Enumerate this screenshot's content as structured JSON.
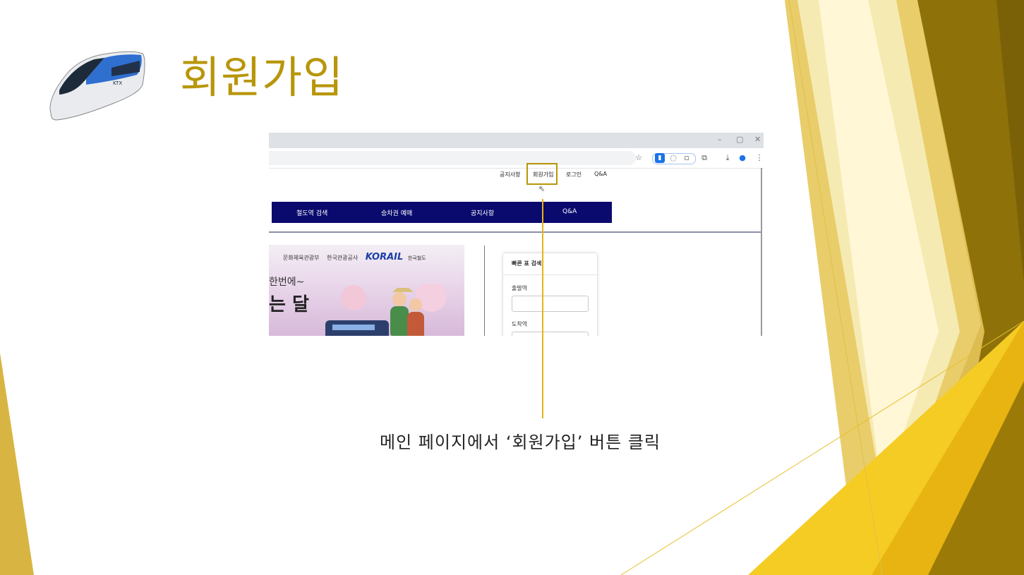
{
  "slide": {
    "title": "회원가입",
    "caption": "메인 페이지에서 ‘회원가입’ 버튼 클릭",
    "accent_color": "#b8960b",
    "decor_colors": [
      "#d9b94a",
      "#efd47a",
      "#c9a11c",
      "#8e7108",
      "#f8dc4a",
      "#fff4c4"
    ]
  },
  "train_image": {
    "icon": "ktx-train-icon",
    "brand_text": "KTX"
  },
  "browser": {
    "window_controls": [
      "–",
      "▢",
      "✕"
    ],
    "toolbar_icons": [
      "star-icon",
      "extension-icon",
      "puzzle-icon",
      "download-icon",
      "profile-icon",
      "menu-icon"
    ]
  },
  "site": {
    "top_links": [
      "공지사항",
      "회원가입",
      "로그인",
      "Q&A"
    ],
    "nav": [
      "철도역 검색",
      "승차권 예매",
      "공지사항",
      "Q&A"
    ],
    "banner": {
      "logos": [
        "문화체육관광부",
        "한국관광공사",
        "KORAIL",
        "한국철도"
      ],
      "text_line1": "한번에~",
      "text_line2": "는 달"
    },
    "quick_search": {
      "title": "빠른 표 검색",
      "departure_label": "출발역",
      "arrival_label": "도착역"
    }
  }
}
